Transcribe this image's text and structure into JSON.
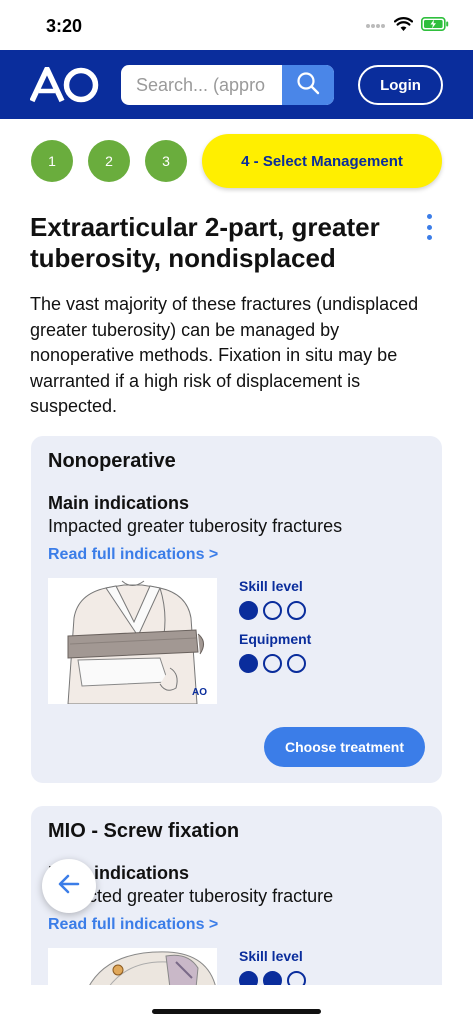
{
  "status": {
    "time": "3:20"
  },
  "header": {
    "logo": "AO",
    "search_placeholder": "Search... (appro",
    "login_label": "Login"
  },
  "steps": {
    "items": [
      "1",
      "2",
      "3"
    ],
    "active_label": "4 - Select Management"
  },
  "page": {
    "title": "Extraarticular 2-part, greater tuberosity, nondisplaced",
    "intro": "The vast majority of these fractures (undisplaced greater tuberosity) can be managed by nonoperative methods. Fixation in situ may be warranted if a high risk of displacement is suspected."
  },
  "cards": [
    {
      "title": "Nonoperative",
      "indications_head": "Main indications",
      "indications_text": "Impacted greater tuberosity fractures",
      "read_more": "Read full indications >",
      "skill_label": "Skill level",
      "skill_level": 1,
      "equipment_label": "Equipment",
      "equipment_level": 1,
      "image_watermark": "AO",
      "choose_label": "Choose treatment"
    },
    {
      "title": "MIO - Screw fixation",
      "indications_head": "Main indications",
      "indications_text": "Impacted greater tuberosity fracture",
      "read_more": "Read full indications >",
      "skill_label": "Skill level",
      "skill_level": 2
    }
  ],
  "colors": {
    "brand_blue": "#0a2d9c",
    "accent_blue": "#3b7de8",
    "step_green": "#6aad3d",
    "step_active_yellow": "#ffef00",
    "card_bg": "#ebeef7"
  }
}
